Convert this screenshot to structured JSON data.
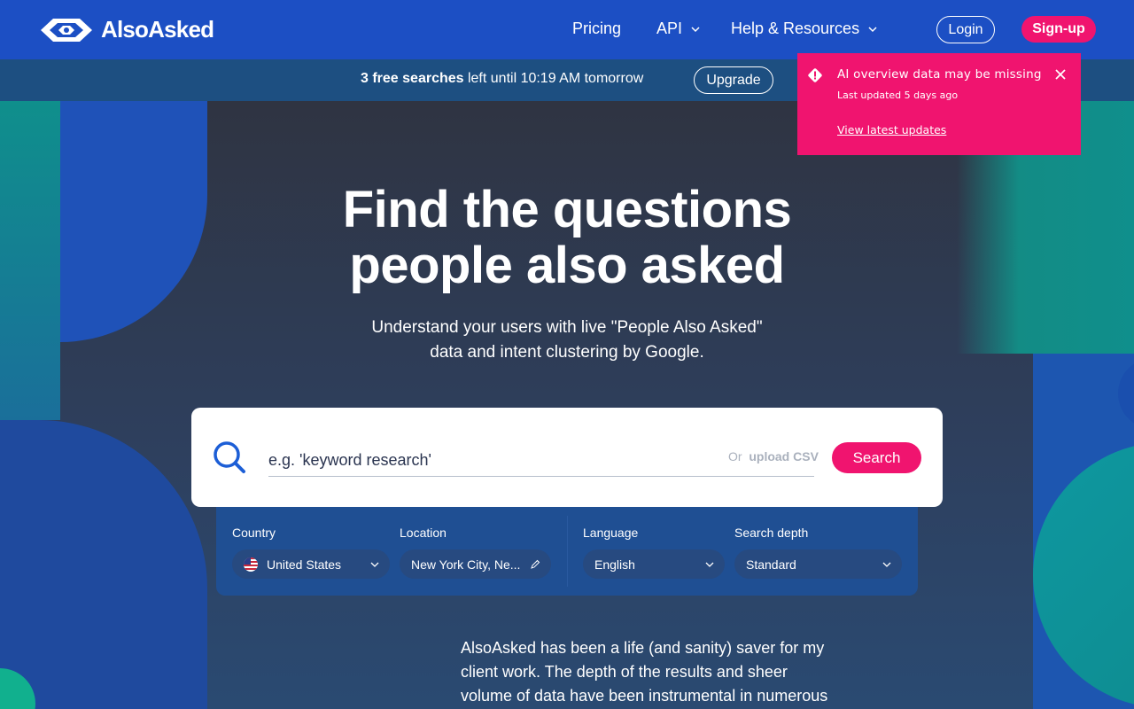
{
  "header": {
    "brand": "AlsoAsked",
    "nav": [
      {
        "label": "Pricing"
      },
      {
        "label": "API"
      },
      {
        "label": "Help & Resources"
      }
    ],
    "login_label": "Login",
    "signup_label": "Sign-up"
  },
  "banner": {
    "count_text": "3 free searches",
    "rest_text": " left until 10:19 AM tomorrow",
    "upgrade_label": "Upgrade"
  },
  "hero": {
    "title_line1": "Find the questions",
    "title_line2": "people also asked",
    "subtitle_line1": "Understand your users with live \"People Also Asked\"",
    "subtitle_line2": "data and intent clustering by Google."
  },
  "search": {
    "placeholder": "e.g. 'keyword research'",
    "upload_or": "Or",
    "upload_label": "upload CSV",
    "button_label": "Search"
  },
  "options": {
    "country_label": "Country",
    "country_value": "United States",
    "location_label": "Location",
    "location_value": "New York City, Ne...",
    "language_label": "Language",
    "language_value": "English",
    "depth_label": "Search depth",
    "depth_value": "Standard"
  },
  "testimonial": {
    "line1": "AlsoAsked has been a life (and sanity) saver for my",
    "line2": "client work. The depth of the results and sheer",
    "line3": "volume of data have been instrumental in numerous"
  },
  "toast": {
    "title": "AI overview data may be missing",
    "subtitle": "Last updated 5 days ago",
    "link": "View latest updates"
  },
  "colors": {
    "nav_blue": "#1c4fc4",
    "accent_pink": "#f0146f",
    "banner_blue": "#1d4f81"
  }
}
